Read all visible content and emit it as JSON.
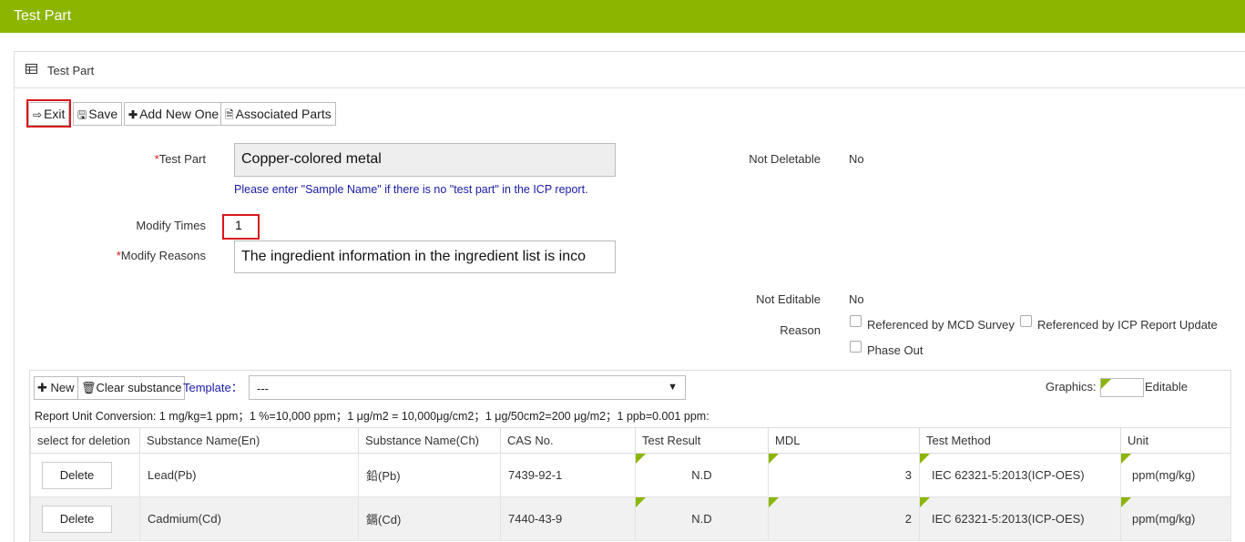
{
  "window": {
    "title": "Test Part"
  },
  "panel": {
    "title": "Test Part"
  },
  "toolbar": {
    "exit": "Exit",
    "save": "Save",
    "add_new": "Add New One",
    "associated": "Associated Parts"
  },
  "form": {
    "test_part_label": "Test Part",
    "test_part_value": "Copper-colored metal",
    "test_part_hint": "Please enter \"Sample Name\" if there is no \"test part\" in the ICP report.",
    "modify_times_label": "Modify Times",
    "modify_times_value": "1",
    "modify_reasons_label": "Modify Reasons",
    "modify_reasons_value": "The ingredient information in the ingredient list is inco",
    "not_deletable_label": "Not Deletable",
    "not_deletable_value": "No",
    "not_editable_label": "Not Editable",
    "not_editable_value": "No",
    "reason_label": "Reason",
    "reasons": [
      "Referenced by MCD Survey",
      "Referenced by ICP Report Update",
      "Phase Out"
    ],
    "required_mark": "*"
  },
  "substance": {
    "new": "New",
    "clear": "Clear substance",
    "template_label": "Template：",
    "template_value": "---",
    "graphics_label": "Graphics:",
    "editable_label": "Editable",
    "conversion": "Report Unit Conversion: 1 mg/kg=1 ppm；1 %=10,000 ppm；1 μg/m2 = 10,000μg/cm2；1 μg/50cm2=200 μg/m2；1 ppb=0.001 ppm:",
    "columns": [
      "select for deletion",
      "Substance Name(En)",
      "Substance Name(Ch)",
      "CAS No.",
      "Test Result",
      "MDL",
      "Test Method",
      "Unit"
    ],
    "rows": [
      {
        "action": "Delete",
        "name_en": "Lead(Pb)",
        "name_ch": "鉛(Pb)",
        "cas": "7439-92-1",
        "result": "N.D",
        "mdl": "3",
        "method": "IEC 62321-5:2013(ICP-OES)",
        "unit": "ppm(mg/kg)"
      },
      {
        "action": "Delete",
        "name_en": "Cadmium(Cd)",
        "name_ch": "鎘(Cd)",
        "cas": "7440-43-9",
        "result": "N.D",
        "mdl": "2",
        "method": "IEC 62321-5:2013(ICP-OES)",
        "unit": "ppm(mg/kg)"
      }
    ]
  },
  "colors": {
    "brand": "#8cb500",
    "highlight": "#d9151c",
    "hint": "#1a1aa6"
  }
}
